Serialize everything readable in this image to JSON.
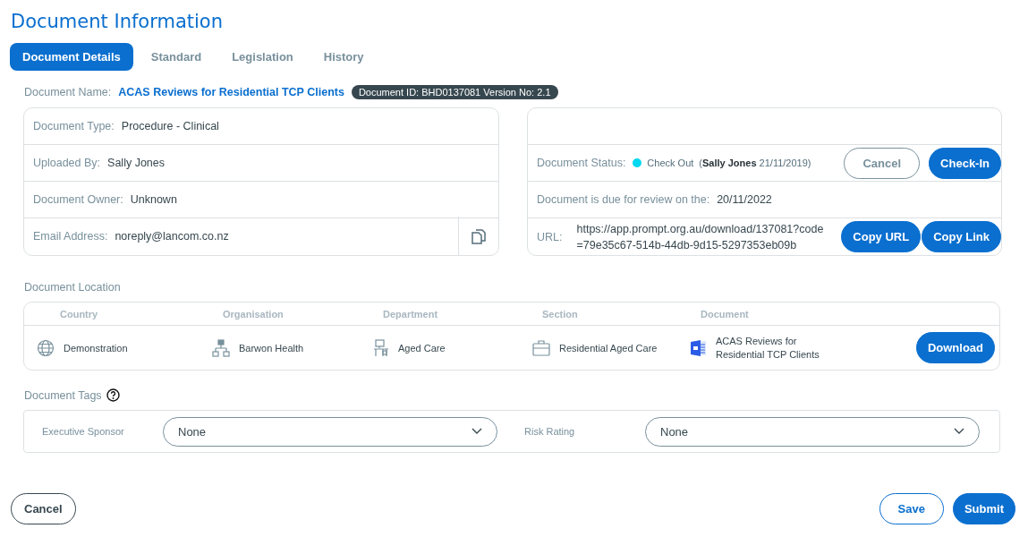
{
  "title": "Document Information",
  "tabs": [
    {
      "label": "Document Details",
      "selected": true
    },
    {
      "label": "Standard",
      "selected": false
    },
    {
      "label": "Legislation",
      "selected": false
    },
    {
      "label": "History",
      "selected": false
    }
  ],
  "document_name": {
    "label": "Document Name:",
    "value": "ACAS Reviews for Residential TCP Clients",
    "badge": "Document ID: BHD0137081 Version No: 2.1"
  },
  "details": [
    {
      "label": "Document Type:",
      "value": "Procedure - Clinical"
    },
    {
      "label": "Uploaded By:",
      "value": "Sally Jones"
    },
    {
      "label": "Document Owner:",
      "value": "Unknown"
    },
    {
      "label": "Email Address:",
      "value": "noreply@lancom.co.nz"
    }
  ],
  "status": {
    "label": "Document Status:",
    "color": "#00d8f0",
    "state": "Check Out",
    "detail": "(**Sally Jones** 21/11/2019)",
    "buttons": [
      {
        "label": "Cancel",
        "kind": "outline"
      },
      {
        "label": "Check-In",
        "kind": "primary"
      }
    ]
  },
  "review": {
    "label": "Document is due for review on the:",
    "value": "20/11/2022"
  },
  "url": {
    "label": "URL:",
    "value": "https://app.prompt.org.au/download/137081?code=79e35c67-514b-44db-9d15-5297353eb09b",
    "buttons": [
      "Copy URL",
      "Copy Link"
    ]
  },
  "location": {
    "title": "Document Location",
    "columns": [
      {
        "heading": "Country",
        "value": "Demonstration",
        "kind": "globe"
      },
      {
        "heading": "Organisation",
        "value": "Barwon Health",
        "kind": "org"
      },
      {
        "heading": "Department",
        "value": "Aged Care",
        "kind": "desk"
      },
      {
        "heading": "Section",
        "value": "Residential Aged Care",
        "kind": "briefcase"
      },
      {
        "heading": "Document",
        "value": "ACAS Reviews for Residential TCP Clients",
        "kind": "word"
      }
    ],
    "button": "Download"
  },
  "tags": {
    "title": "Document Tags",
    "fields": [
      {
        "label": "Executive Sponsor",
        "value": "None"
      },
      {
        "label": "Risk Rating",
        "value": "None"
      }
    ]
  },
  "footer": {
    "left": [
      {
        "label": "Cancel",
        "kind": "dark"
      }
    ],
    "right": [
      {
        "label": "Save",
        "kind": "outline"
      },
      {
        "label": "Submit",
        "kind": "primary"
      }
    ]
  }
}
